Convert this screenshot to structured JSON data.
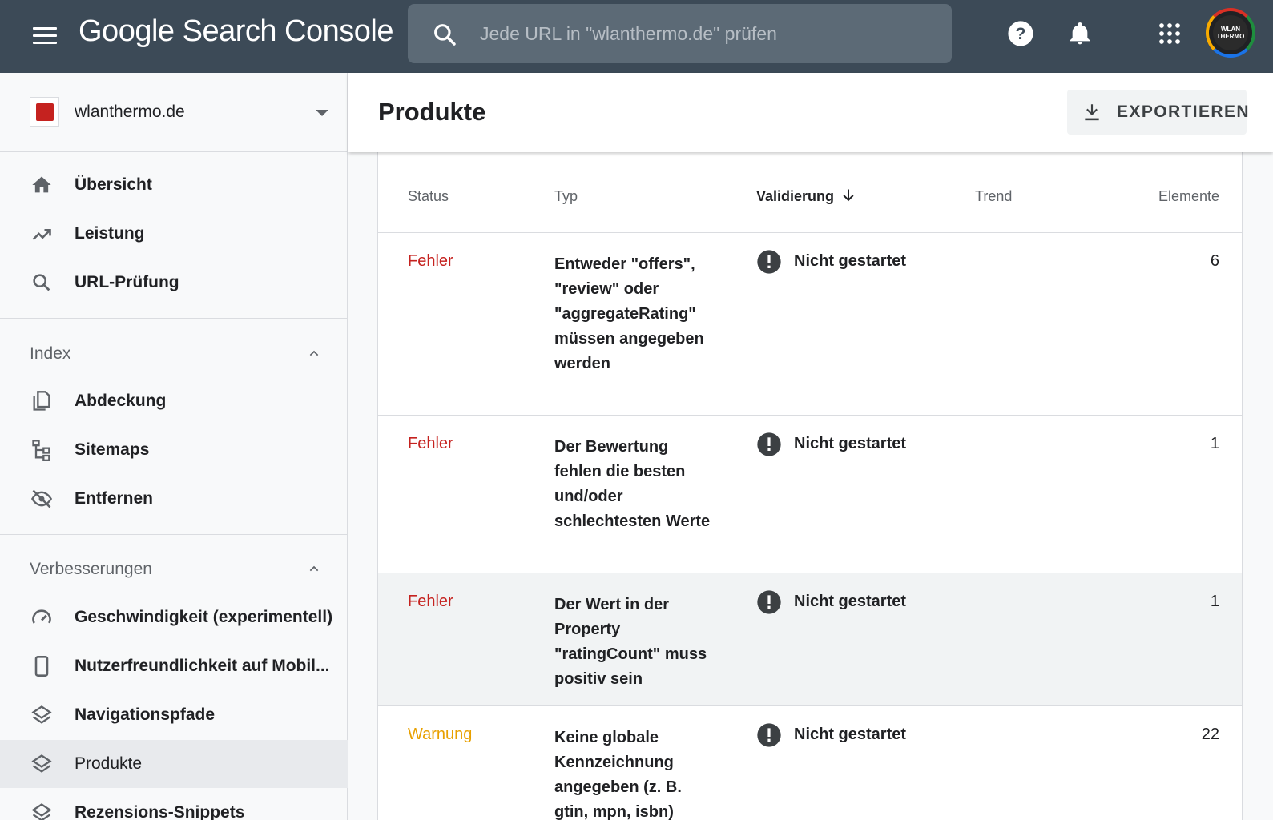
{
  "header": {
    "app_title": "Google Search Console",
    "search_placeholder": "Jede URL in \"wlanthermo.de\" prüfen",
    "avatar_text": "WLAN THERMO"
  },
  "sidebar": {
    "property": "wlanthermo.de",
    "top_items": [
      {
        "label": "Übersicht",
        "icon": "home-icon"
      },
      {
        "label": "Leistung",
        "icon": "trending-up-icon"
      },
      {
        "label": "URL-Prüfung",
        "icon": "search-icon"
      }
    ],
    "index_section": {
      "label": "Index",
      "items": [
        {
          "label": "Abdeckung",
          "icon": "file-copy-icon"
        },
        {
          "label": "Sitemaps",
          "icon": "sitemap-icon"
        },
        {
          "label": "Entfernen",
          "icon": "visibility-off-icon"
        }
      ]
    },
    "improvements_section": {
      "label": "Verbesserungen",
      "items": [
        {
          "label": "Geschwindigkeit (experimentell)",
          "icon": "speed-icon"
        },
        {
          "label": "Nutzerfreundlichkeit auf Mobil...",
          "icon": "smartphone-icon"
        },
        {
          "label": "Navigationspfade",
          "icon": "layers-icon"
        },
        {
          "label": "Produkte",
          "icon": "layers-icon",
          "active": true
        },
        {
          "label": "Rezensions-Snippets",
          "icon": "layers-icon"
        }
      ]
    }
  },
  "main": {
    "title": "Produkte",
    "export_label": "EXPORTIEREN",
    "columns": {
      "status": "Status",
      "type": "Typ",
      "validation": "Validierung",
      "trend": "Trend",
      "items": "Elemente"
    },
    "rows": [
      {
        "status": "Fehler",
        "type": "Entweder \"offers\", \"review\" oder \"aggregateRating\" müssen angegeben werden",
        "validation": "Nicht gestartet",
        "count": "6"
      },
      {
        "status": "Fehler",
        "type": "Der Bewertung fehlen die besten und/oder schlechtesten Werte",
        "validation": "Nicht gestartet",
        "count": "1"
      },
      {
        "status": "Fehler",
        "type": "Der Wert in der Property \"ratingCount\" muss positiv sein",
        "validation": "Nicht gestartet",
        "count": "1"
      },
      {
        "status": "Warnung",
        "type": "Keine globale Kennzeichnung angegeben (z. B. gtin, mpn, isbn)",
        "validation": "Nicht gestartet",
        "count": "22"
      }
    ]
  },
  "colors": {
    "topbar": "#3c4a57",
    "error": "#c5221f",
    "warning": "#e8a000"
  }
}
